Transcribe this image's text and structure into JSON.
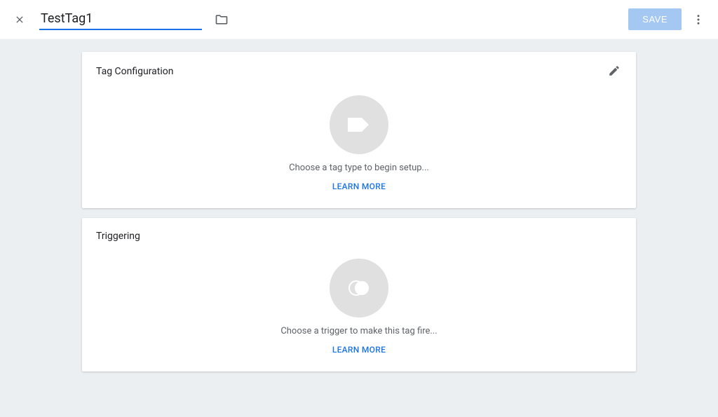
{
  "header": {
    "title_value": "TestTag1",
    "save_label": "SAVE"
  },
  "tag_config": {
    "title": "Tag Configuration",
    "empty_text": "Choose a tag type to begin setup...",
    "learn_more": "LEARN MORE"
  },
  "triggering": {
    "title": "Triggering",
    "empty_text": "Choose a trigger to make this tag fire...",
    "learn_more": "LEARN MORE"
  }
}
